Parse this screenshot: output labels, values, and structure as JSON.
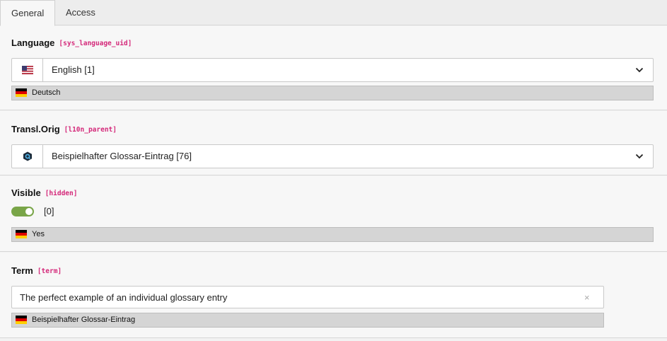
{
  "tabs": [
    {
      "label": "General",
      "active": true
    },
    {
      "label": "Access",
      "active": false
    }
  ],
  "language": {
    "label": "Language",
    "key": "[sys_language_uid]",
    "value": "English [1]",
    "flag_icon": "flag-us-icon",
    "original": "Deutsch"
  },
  "transl_orig": {
    "label": "Transl.Orig",
    "key": "[l10n_parent]",
    "value": "Beispielhafter Glossar-Eintrag [76]",
    "record_icon": "glossary-record-icon"
  },
  "visible": {
    "label": "Visible",
    "key": "[hidden]",
    "toggle_on": true,
    "value": "[0]",
    "original": "Yes"
  },
  "term": {
    "label": "Term",
    "key": "[term]",
    "value": "The perfect example of an individual glossary entry",
    "clear_symbol": "×",
    "original": "Beispielhafter Glossar-Eintrag"
  },
  "colors": {
    "accent_key": "#d4297a",
    "toggle_green": "#79a548",
    "border": "#c9c9c9"
  }
}
